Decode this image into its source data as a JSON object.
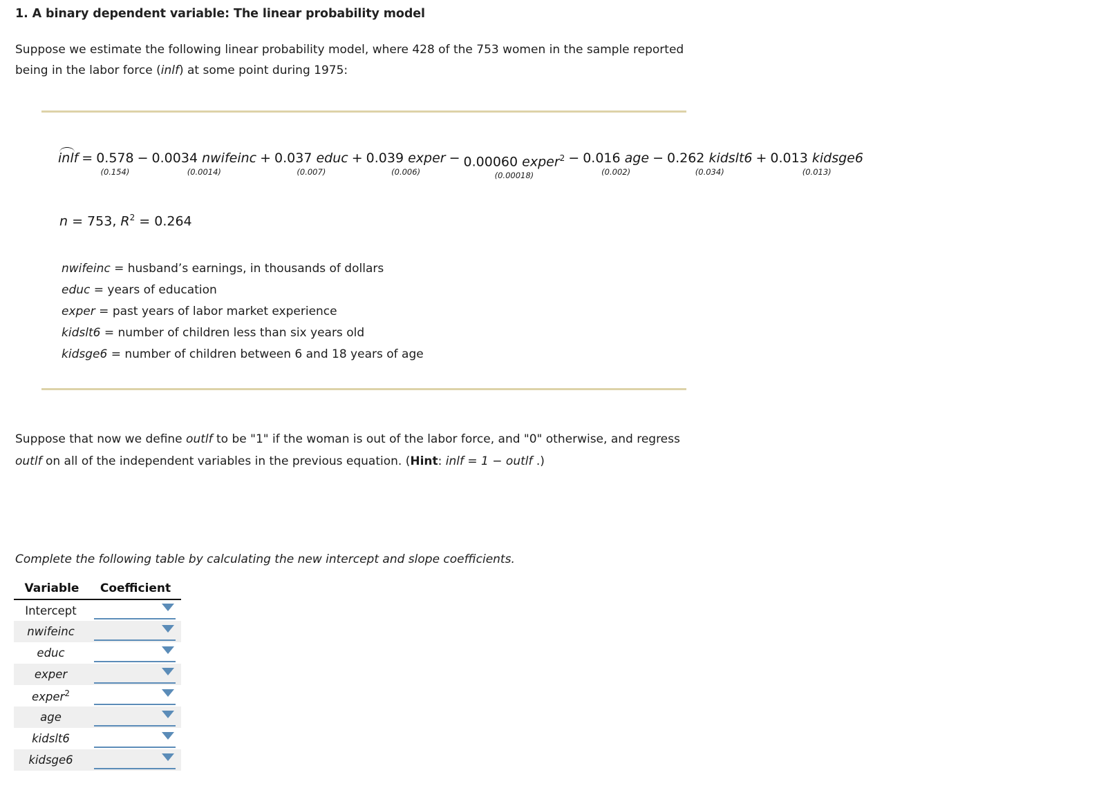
{
  "heading": {
    "title": "1. A binary dependent variable: The linear probability model"
  },
  "intro": {
    "line1_a": "Suppose we estimate the following linear probability model, where 428 of the 753 women in the sample reported",
    "line2_a": "being in the labor force (",
    "line2_var": "inlf",
    "line2_b": ") at some point during 1975:"
  },
  "equation": {
    "lhs": "inlf",
    "equals": "=",
    "terms": [
      {
        "op": "",
        "coef": "0.578",
        "se": "(0.154)",
        "var": ""
      },
      {
        "op": "−",
        "coef": "0.0034",
        "se": "(0.0014)",
        "var": "nwifeinc"
      },
      {
        "op": "+",
        "coef": "0.037",
        "se": "(0.007)",
        "var": "educ"
      },
      {
        "op": "+",
        "coef": "0.039",
        "se": "(0.006)",
        "var": "exper"
      },
      {
        "op": "−",
        "coef": "0.00060",
        "se": "(0.00018)",
        "var": "exper",
        "sup": "2"
      },
      {
        "op": "−",
        "coef": "0.016",
        "se": "(0.002)",
        "var": "age"
      },
      {
        "op": "−",
        "coef": "0.262",
        "se": "(0.034)",
        "var": "kidslt6"
      },
      {
        "op": "+",
        "coef": "0.013",
        "se": "(0.013)",
        "var": "kidsge6"
      }
    ],
    "stats": {
      "n_label": "n",
      "n_value": "753",
      "r2_label": "R",
      "r2_sup": "2",
      "r2_value": "0.264"
    }
  },
  "definitions": [
    {
      "var": "nwifeinc",
      "text": "= husband’s earnings, in thousands of dollars"
    },
    {
      "var": "educ",
      "text": "= years of education"
    },
    {
      "var": "exper",
      "text": "= past years of labor market experience"
    },
    {
      "var": "kidslt6",
      "text": "= number of children less than six years old"
    },
    {
      "var": "kidsge6",
      "text": "= number of children between 6 and 18 years of age"
    }
  ],
  "paragraph2": {
    "p1": "Suppose that now we define ",
    "var1": "outlf",
    "p2": " to be \"1\" if the woman is out of the labor force, and \"0\" otherwise, and regress",
    "var2": "outlf",
    "p3": " on all of the independent variables in the previous equation. (",
    "hint_label": "Hint",
    "p4": ": ",
    "hint_math": "inlf = 1 − outlf",
    "p5": " .)"
  },
  "table": {
    "caption": "Complete the following table by calculating the new intercept and slope coefficients.",
    "headers": {
      "variable": "Variable",
      "coefficient": "Coefficient"
    },
    "rows": [
      {
        "variable": "Intercept",
        "italic": false,
        "sup": "",
        "coefficient": ""
      },
      {
        "variable": "nwifeinc",
        "italic": true,
        "sup": "",
        "coefficient": ""
      },
      {
        "variable": "educ",
        "italic": true,
        "sup": "",
        "coefficient": ""
      },
      {
        "variable": "exper",
        "italic": true,
        "sup": "",
        "coefficient": ""
      },
      {
        "variable": "exper",
        "italic": true,
        "sup": "2",
        "coefficient": ""
      },
      {
        "variable": "age",
        "italic": true,
        "sup": "",
        "coefficient": ""
      },
      {
        "variable": "kidslt6",
        "italic": true,
        "sup": "",
        "coefficient": ""
      },
      {
        "variable": "kidsge6",
        "italic": true,
        "sup": "",
        "coefficient": ""
      }
    ]
  },
  "colors": {
    "rule": "#ddd2a8",
    "dropdown_blue": "#5b8cb8",
    "row_shade": "#efefef",
    "text": "#1a1a1a"
  }
}
